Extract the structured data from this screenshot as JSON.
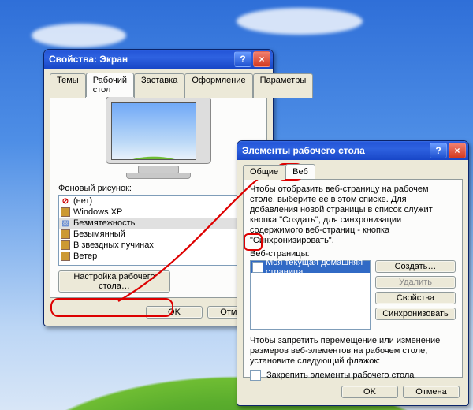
{
  "dialog1": {
    "title": "Свойства: Экран",
    "tabs": [
      "Темы",
      "Рабочий стол",
      "Заставка",
      "Оформление",
      "Параметры"
    ],
    "active_tab_index": 1,
    "wallpaper_label": "Фоновый рисунок:",
    "wallpapers": [
      {
        "name": "(нет)",
        "icon": "none"
      },
      {
        "name": "Windows XP",
        "icon": "bmp"
      },
      {
        "name": "Безмятежность",
        "icon": "theme",
        "selected": true
      },
      {
        "name": "Безымянный",
        "icon": "bmp"
      },
      {
        "name": "В звездных пучинах",
        "icon": "bmp"
      },
      {
        "name": "Ветер",
        "icon": "bmp"
      }
    ],
    "customize_btn": "Настройка рабочего стола…",
    "ok": "OK",
    "cancel": "Отмена"
  },
  "dialog2": {
    "title": "Элементы рабочего стола",
    "tabs": [
      "Общие",
      "Веб"
    ],
    "active_tab_index": 1,
    "instructions": "Чтобы отобразить веб-страницу на рабочем столе, выберите ее в этом списке. Для добавления новой страницы в список служит кнопка \"Создать\", для синхронизации содержимого веб-страниц - кнопка \"Синхронизировать\".",
    "weblist_label": "Веб-страницы:",
    "weblist_items": [
      {
        "label": "Моя текущая домашняя страница",
        "checked": false,
        "selected": true
      }
    ],
    "btn_create": "Создать…",
    "btn_delete": "Удалить",
    "btn_props": "Свойства",
    "btn_sync": "Синхронизовать",
    "lock_instructions": "Чтобы запретить перемещение или изменение размеров веб-элементов на рабочем столе, установите следующий флажок:",
    "lock_checkbox": "Закрепить элементы рабочего стола",
    "lock_checked": false,
    "ok": "OK",
    "cancel": "Отмена"
  }
}
